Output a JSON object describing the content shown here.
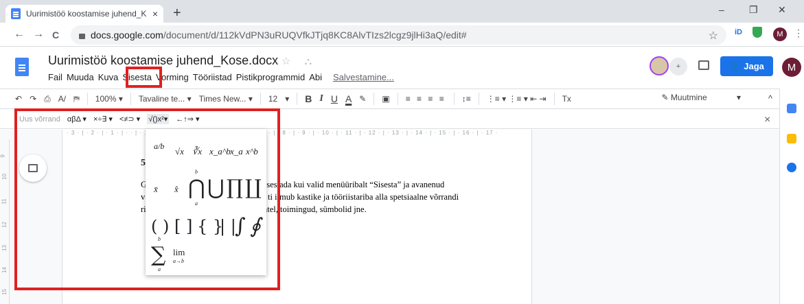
{
  "browser": {
    "tab_title": "Uurimistöö koostamise juhend_K",
    "tab_close": "×",
    "new_tab": "+",
    "url_host": "docs.google.com",
    "url_path": "/document/d/112kVdPN3uRUQVfkJTjq8KC8AlvTIzs2lcgz9jlHi3aQ/edit#",
    "ext_id": "iD",
    "profile_initial": "M",
    "back": "←",
    "forward": "→",
    "reload": "C",
    "star": "☆",
    "minimize": "–",
    "restore": "❐",
    "close": "✕",
    "more": "⋮"
  },
  "docs": {
    "title": "Uurimistöö koostamise juhend_Kose.docx",
    "title_icons": "☆ ⛬",
    "menus": [
      "Fail",
      "Muuda",
      "Kuva",
      "Sisesta",
      "Vorming",
      "Tööriistad",
      "Pistikprogrammid",
      "Abi"
    ],
    "save_status": "Salvestamine...",
    "share_label": "Jaga",
    "avatar_initial": "M",
    "collab_label": "+"
  },
  "toolbar": {
    "undo": "↶",
    "redo": "↷",
    "print": "⎙",
    "spell": "A/",
    "paint": "⛿",
    "zoom": "100% ▾",
    "style": "Tavaline te... ▾",
    "font": "Times New... ▾",
    "size": "12",
    "size_arrow": "▾",
    "bold": "B",
    "italic": "I",
    "underline": "U",
    "textcolor": "A",
    "highlight": "✎",
    "image": "▣",
    "align": "≡ ≡ ≡ ≡",
    "linespacing": "↕≡",
    "lists": "⋮≡ ▾ ⋮≡ ▾ ⇤ ⇥",
    "clear": "Tx",
    "mode": "✎ Muutmine",
    "mode_arrow": "▾",
    "collapse": "^"
  },
  "equation_bar": {
    "new": "Uus võrrand",
    "groups": [
      "αβΔ ▾",
      "×÷∃ ▾",
      "<≠⊃ ▾",
      "√()x²▾",
      "←↑⇒ ▾"
    ],
    "close": "×"
  },
  "ruler": {
    "horizontal": "· 3 · | · 2 · | · 1 · | ·   · | · 1 · | · 2 · | · 3 · | · 4 · | · 5 · | · 6 · | · 7 · | · 8 · | · 9 · | · 10 · | · 11 · | · 12 · | · 13 · | · 14 · | · 15 · | · 16 · | · 17 ·",
    "vertical": [
      "9",
      "10",
      "11",
      "12",
      "13",
      "14",
      "15"
    ]
  },
  "document": {
    "heading": "5",
    "lines": [
      "G",
      "sisestada kui valid menüüribalt “Sisesta” ja avanenud",
      "v",
      "ti ilmub kastike ja tööriistariba alla spetsiaalne võrrandi",
      "ri",
      "htel, toimingud, sümbolid jne."
    ]
  },
  "equation_panel": {
    "row1": [
      "a/b",
      "√x",
      "∛x",
      "x_a^b",
      "x_a",
      "x^b"
    ],
    "row2": [
      "x̄",
      "x̂",
      "⋂",
      "⋃",
      "∏",
      "∐"
    ],
    "row3": [
      "( )",
      "[ ]",
      "{ }",
      "| |",
      "∫",
      "∮"
    ],
    "row4": [
      "∑",
      "lim"
    ],
    "lim_sub": "a→b",
    "bound_top": "b",
    "bound_bottom": "a"
  }
}
